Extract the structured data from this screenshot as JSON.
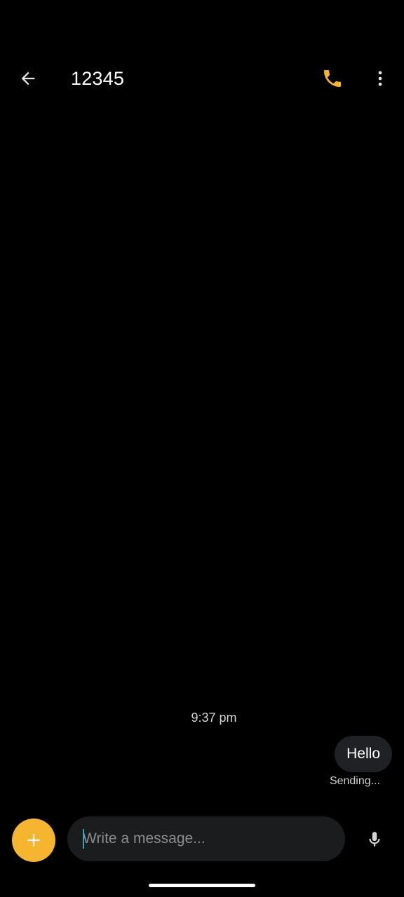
{
  "header": {
    "title": "12345",
    "back_icon": "arrow-left-icon",
    "call_icon": "phone-icon",
    "more_icon": "more-vert-icon"
  },
  "conversation": {
    "timestamp": "9:37 pm",
    "messages": [
      {
        "text": "Hello",
        "status": "Sending..."
      }
    ]
  },
  "composer": {
    "placeholder": "Write a message...",
    "value": "",
    "add_icon": "plus-icon",
    "mic_icon": "microphone-icon"
  },
  "colors": {
    "background": "#000000",
    "accent": "#f5b52e",
    "bubble": "#202124",
    "composer_bg": "#1b1c1e",
    "caret": "#2fa3d8"
  }
}
